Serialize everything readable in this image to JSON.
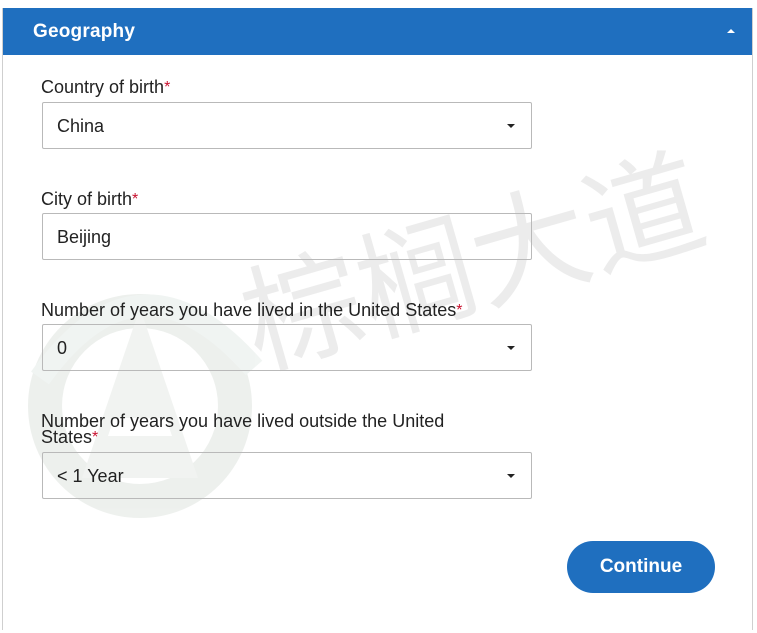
{
  "section": {
    "title": "Geography",
    "toggle_icon": "chevron-up-icon"
  },
  "required_marker": "*",
  "fields": {
    "country_of_birth": {
      "label": "Country of birth",
      "value": "China",
      "type": "select"
    },
    "city_of_birth": {
      "label": "City of birth",
      "value": "Beijing",
      "type": "text"
    },
    "years_in_us": {
      "label": "Number of years you have lived in the United States",
      "value": "0",
      "type": "select"
    },
    "years_outside_us": {
      "label_line1": "Number of years you have lived outside the United",
      "label_line2": "States",
      "value": "< 1 Year",
      "type": "select"
    }
  },
  "actions": {
    "continue_label": "Continue"
  },
  "watermark": {
    "text": "棕榈大道"
  },
  "colors": {
    "header_bg": "#1f6fbf",
    "button_bg": "#1f6fbf",
    "required": "#c8102e"
  }
}
